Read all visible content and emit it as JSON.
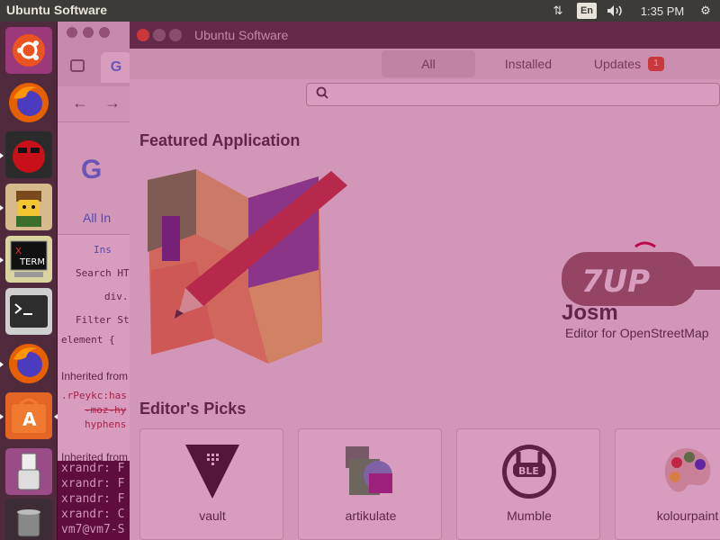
{
  "top_panel": {
    "app_name": "Ubuntu Software",
    "keyboard_layout": "En",
    "time": "1:35 PM"
  },
  "launcher": {
    "items": [
      {
        "name": "ubuntu-dash",
        "icon": "ubuntu-logo-icon"
      },
      {
        "name": "firefox",
        "icon": "firefox-icon"
      },
      {
        "name": "game-red",
        "icon": "angry-face-icon"
      },
      {
        "name": "game-lego",
        "icon": "lego-figure-icon"
      },
      {
        "name": "xterm",
        "icon": "xterm-icon",
        "label": "X TERM"
      },
      {
        "name": "terminal",
        "icon": "terminal-icon",
        "label": ">_"
      },
      {
        "name": "firefox-2",
        "icon": "firefox-icon"
      },
      {
        "name": "ubuntu-software",
        "icon": "software-center-icon",
        "label": "A"
      },
      {
        "name": "usb-drive",
        "icon": "usb-icon"
      },
      {
        "name": "trash",
        "icon": "trash-icon"
      }
    ]
  },
  "background_app": {
    "tab_letter": "G",
    "google_letter": "G",
    "tabs_text": "All   In",
    "devtools_lines": [
      "Ins",
      "Search HTM",
      "div.",
      "Filter Style",
      "element {",
      "Inherited from",
      ".rPeykc:has",
      "-moz-hy",
      "hyphens",
      "Inherited from"
    ],
    "terminal_lines": [
      "xrandr: F",
      "xrandr: F",
      "xrandr: F",
      "xrandr: C",
      "vm7@vm7-S"
    ]
  },
  "window": {
    "title": "Ubuntu Software",
    "tabs": {
      "all": "All",
      "installed": "Installed",
      "updates": "Updates",
      "updates_count": "1"
    },
    "search_placeholder": ""
  },
  "content": {
    "featured_heading": "Featured Application",
    "featured_name": "Josm",
    "featured_description": "Editor for OpenStreetMap",
    "featured_logo_text": "7UP",
    "picks_heading": "Editor's Picks",
    "picks": [
      {
        "name": "vault",
        "icon": "vault-icon"
      },
      {
        "name": "artikulate",
        "icon": "artikulate-icon"
      },
      {
        "name": "Mumble",
        "icon": "mumble-icon",
        "icon_text": "BLE"
      },
      {
        "name": "kolourpaint",
        "icon": "palette-icon"
      }
    ]
  },
  "colors": {
    "overlay": "#a01464",
    "accent": "#e95420",
    "panel": "#3c3b37"
  }
}
